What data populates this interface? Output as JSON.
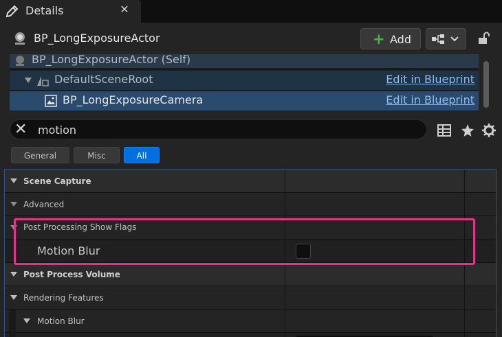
{
  "tab": {
    "title": "Details",
    "close": "✕"
  },
  "header": {
    "actor_name": "BP_LongExposureActor",
    "add_label": "Add",
    "add_plus": "+"
  },
  "tree": {
    "self_label": "BP_LongExposureActor (Self)",
    "root_label": "DefaultSceneRoot",
    "camera_label": "BP_LongExposureCamera",
    "edit_link": "Edit in Blueprint"
  },
  "search": {
    "value": "motion",
    "clear": "✕"
  },
  "filters": {
    "general": "General",
    "misc": "Misc",
    "all": "All"
  },
  "properties": {
    "scene_capture": "Scene Capture",
    "advanced": "Advanced",
    "post_processing_show_flags": "Post Processing Show Flags",
    "motion_blur": "Motion Blur",
    "post_process_volume": "Post Process Volume",
    "rendering_features": "Rendering Features",
    "motion_blur_group": "Motion Blur"
  },
  "colors": {
    "accent": "#0070e0",
    "highlight": "#e0358a",
    "link": "#8fbbef",
    "add_green": "#52b24a"
  }
}
